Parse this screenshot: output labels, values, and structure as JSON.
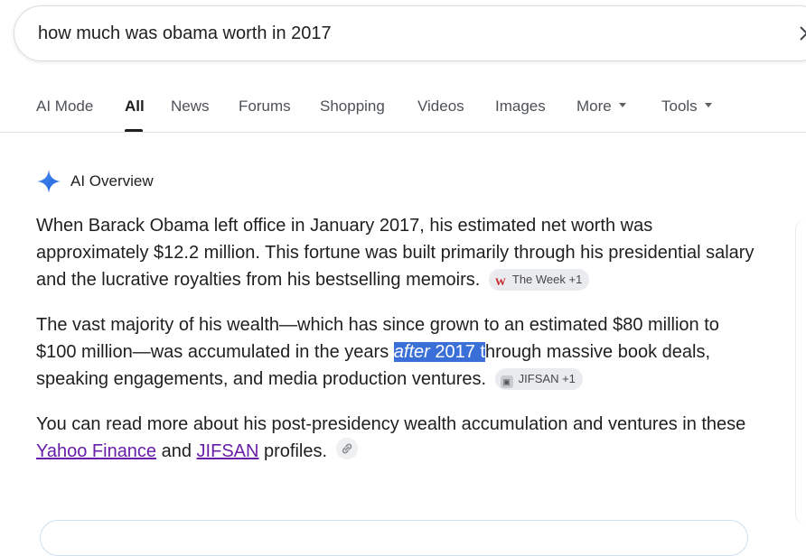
{
  "search": {
    "query": "how much was obama worth in 2017"
  },
  "tabs": [
    {
      "label": "AI Mode"
    },
    {
      "label": "All"
    },
    {
      "label": "News"
    },
    {
      "label": "Forums"
    },
    {
      "label": "Shopping"
    },
    {
      "label": "Videos"
    },
    {
      "label": "Images"
    },
    {
      "label": "More"
    },
    {
      "label": "Tools"
    }
  ],
  "ai_overview": {
    "title": "AI Overview",
    "p1": {
      "text": "When Barack Obama left office in January 2017, his estimated net worth was approximately $12.2 million. This fortune was built primarily through his presidential salary and the lucrative royalties from his bestselling memoirs.",
      "chip": "The Week +1"
    },
    "p2": {
      "before": "The vast majority of his wealth—which has since grown to an estimated $80 million to $100 million—was accumulated in the years ",
      "hl_italic": "after",
      "hl_plain": " 2017 t",
      "after": "hrough massive book deals, speaking engagements, and media production ventures.",
      "chip": "JIFSAN +1"
    },
    "p3": {
      "before": "You can read more about his post-presidency wealth accumulation and ventures in these ",
      "link1": "Yahoo Finance",
      "mid": " and ",
      "link2": "JIFSAN",
      "after": " profiles."
    }
  },
  "colors": {
    "accent_blue": "#3a6fd8",
    "link": "#681da8",
    "chip_bg": "#e9ebee"
  },
  "icons": [
    "close-icon",
    "caret-down-icon",
    "sparkle-icon",
    "the-week-icon",
    "jifsan-icon",
    "link-icon"
  ]
}
